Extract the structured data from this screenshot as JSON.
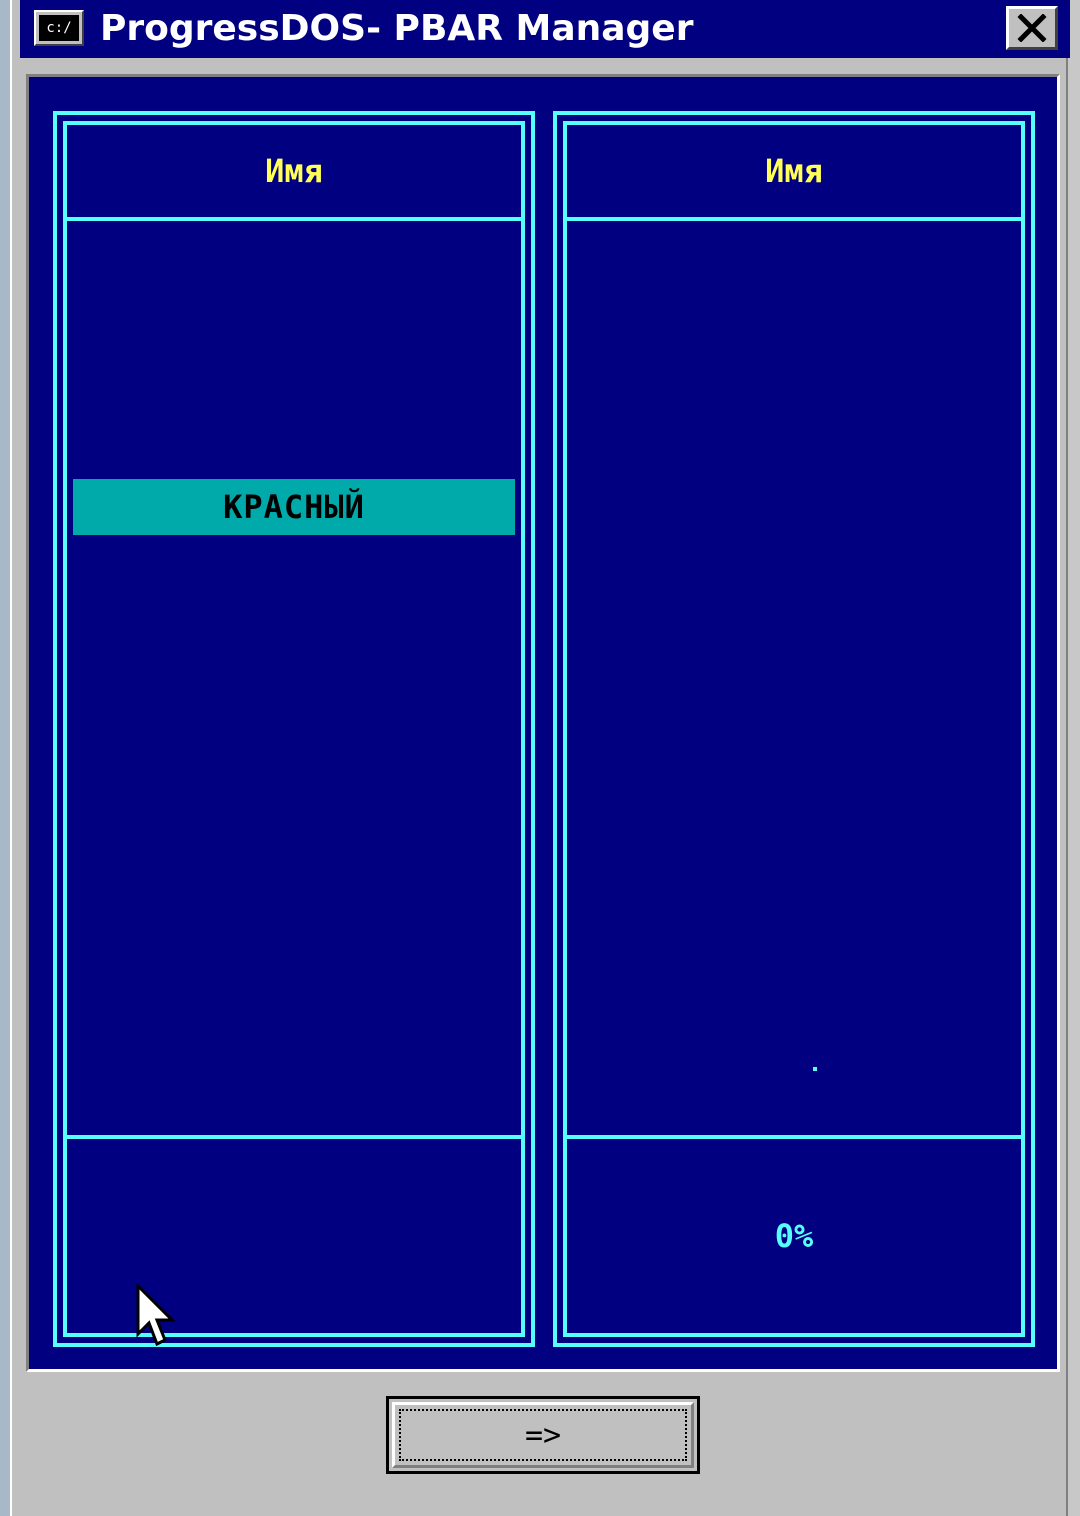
{
  "window": {
    "title": "ProgressDOS- PBAR Manager",
    "icon": "msdos-prompt-icon",
    "icon_text": "c:/",
    "close_icon": "close-x-icon"
  },
  "colors": {
    "background": "#000080",
    "border": "#55ffff",
    "header_text": "#ffff55",
    "selection": "#00aaaa",
    "footer_text": "#55ffff",
    "chrome": "#c0c0c0"
  },
  "left_panel": {
    "header": "Имя",
    "items": [
      {
        "label": "КРАСНЫЙ",
        "selected": true
      }
    ],
    "footer": ""
  },
  "right_panel": {
    "header": "Имя",
    "items": [],
    "footer": "0%"
  },
  "move_button": {
    "label": "=>"
  }
}
